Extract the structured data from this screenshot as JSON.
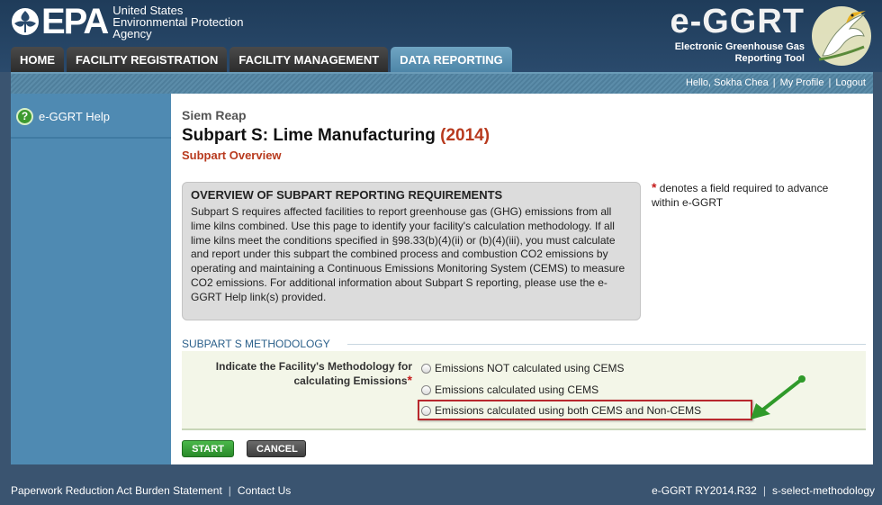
{
  "header": {
    "epa_mark": "EPA",
    "epa_name_lines": [
      "United States",
      "Environmental Protection",
      "Agency"
    ],
    "app_title": "e-GGRT",
    "app_subtitle_lines": [
      "Electronic Greenhouse Gas",
      "Reporting Tool"
    ]
  },
  "nav": {
    "tabs": [
      {
        "label": "HOME"
      },
      {
        "label": "FACILITY REGISTRATION"
      },
      {
        "label": "FACILITY MANAGEMENT"
      },
      {
        "label": "DATA REPORTING"
      }
    ],
    "active": "DATA REPORTING"
  },
  "userbar": {
    "greeting": "Hello, Sokha Chea",
    "profile": "My Profile",
    "logout": "Logout"
  },
  "sidebar": {
    "help_label": "e-GGRT Help",
    "help_icon_glyph": "?"
  },
  "main": {
    "facility": "Siem Reap",
    "title": "Subpart S: Lime Manufacturing",
    "year": "(2014)",
    "section": "Subpart Overview",
    "overview": {
      "heading": "OVERVIEW OF SUBPART REPORTING REQUIREMENTS",
      "text": "Subpart S requires affected facilities to report greenhouse gas (GHG) emissions from all lime kilns combined. Use this page to identify your facility's calculation methodology. If all lime kilns meet the conditions specified in §98.33(b)(4)(ii) or (b)(4)(iii), you must calculate and report under this subpart the combined process and combustion CO2 emissions by operating and maintaining a Continuous Emissions Monitoring System (CEMS) to measure CO2 emissions. For additional information about Subpart S reporting, please use the e-GGRT Help link(s) provided."
    },
    "required_note": {
      "star": "*",
      "text": "denotes a field required to advance within e-GGRT"
    },
    "methodology": {
      "heading": "SUBPART S METHODOLOGY",
      "label": "Indicate the Facility's Methodology for calculating Emissions",
      "star": "*",
      "options": [
        "Emissions NOT calculated using CEMS",
        "Emissions calculated using CEMS",
        "Emissions calculated using both CEMS and Non-CEMS"
      ]
    },
    "buttons": {
      "start": "START",
      "cancel": "CANCEL"
    }
  },
  "footer": {
    "paperwork": "Paperwork Reduction Act Burden Statement",
    "contact": "Contact Us",
    "version": "e-GGRT RY2014.R32",
    "page_id": "s-select-methodology"
  },
  "colors": {
    "brand_dark": "#2a4a6c",
    "tab_active": "#5e95b6",
    "sidebar": "#4f8ab2",
    "accent_red": "#b83a1e",
    "start_green": "#2a8a2a",
    "arrow_green": "#2f9a2a"
  }
}
